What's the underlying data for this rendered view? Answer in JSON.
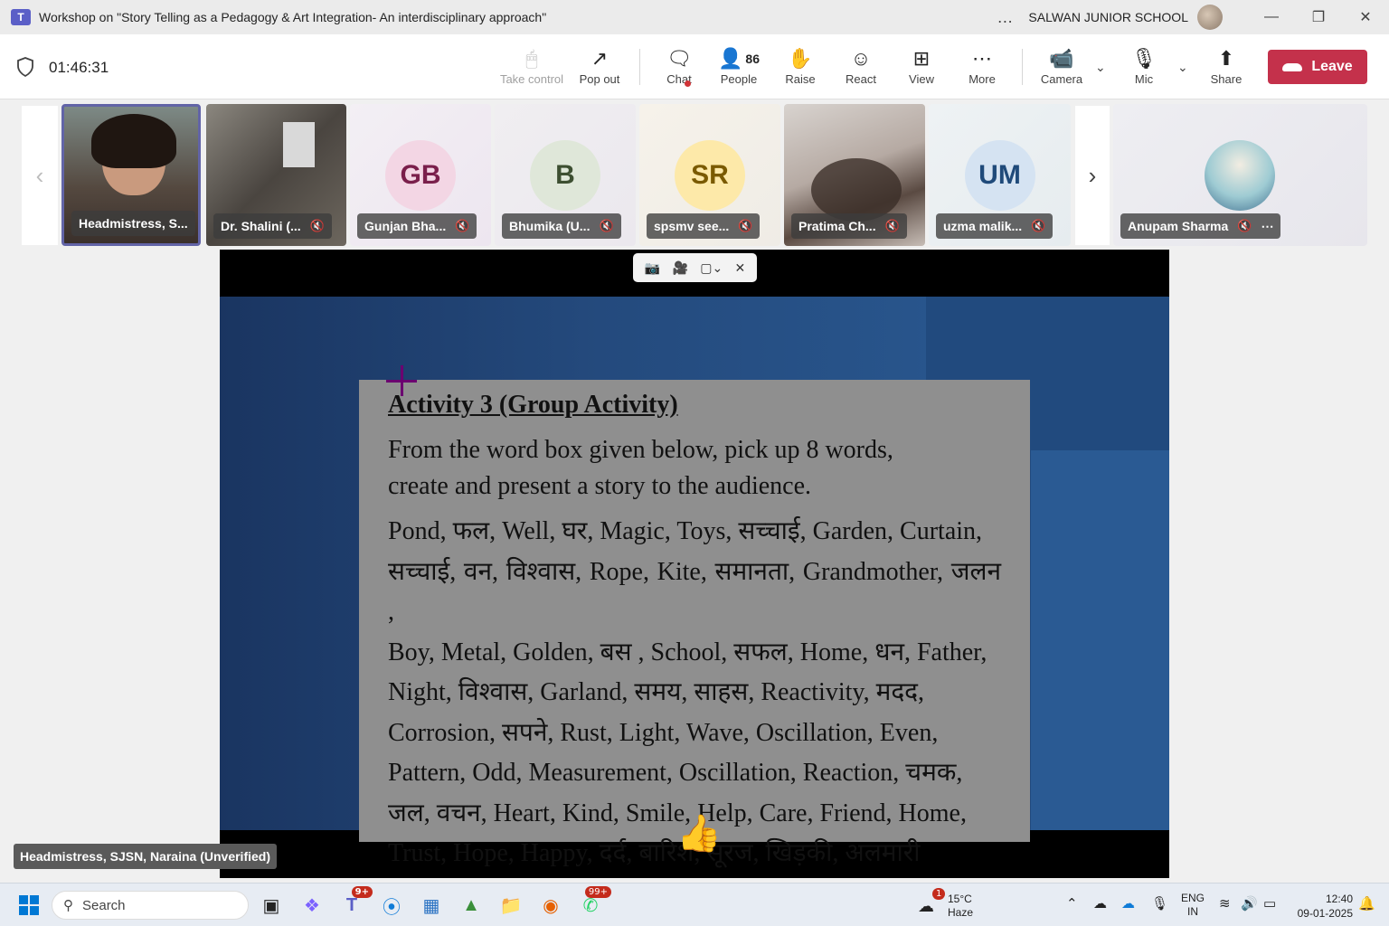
{
  "window": {
    "title": "Workshop on \"Story Telling as a Pedagogy & Art Integration- An interdisciplinary approach\"",
    "more": "…",
    "organization": "SALWAN JUNIOR SCHOOL"
  },
  "toolbar": {
    "timer": "01:46:31",
    "take_control": "Take control",
    "pop_out": "Pop out",
    "chat": "Chat",
    "people": "People",
    "people_count": "86",
    "raise": "Raise",
    "react": "React",
    "view": "View",
    "more": "More",
    "camera": "Camera",
    "mic": "Mic",
    "share": "Share",
    "leave": "Leave"
  },
  "participants": [
    {
      "name": "Headmistress, S..."
    },
    {
      "name": "Dr. Shalini (..."
    },
    {
      "initials": "GB",
      "name": "Gunjan Bha...",
      "color": "#f3d6e4",
      "text_color": "#7a1f4b"
    },
    {
      "initials": "B",
      "name": "Bhumika (U...",
      "color": "#dfe7d9",
      "text_color": "#3d4f31"
    },
    {
      "initials": "SR",
      "name": "spsmv see...",
      "color": "#fde9a9",
      "text_color": "#7a5a00"
    },
    {
      "name": "Pratima Ch..."
    },
    {
      "initials": "UM",
      "name": "uzma malik...",
      "color": "#d5e3f2",
      "text_color": "#1f4a7a"
    },
    {
      "name": "Anupam Sharma"
    }
  ],
  "slide": {
    "title": "Activity 3 (Group Activity)",
    "intro_line1": "From the word box given below, pick up 8 words,",
    "intro_line2": "create and present a story to the audience.",
    "lines": [
      "Pond, फल, Well, घर,  Magic, Toys, सच्चाई,  Garden, Curtain,",
      "सच्चाई, वन, विश्वास, Rope, Kite, समानता, Grandmother, जलन ,",
      "Boy, Metal, Golden, बस , School, सफल, Home, धन, Father,",
      "Night, विश्वास, Garland, समय, साहस,   Reactivity, मदद,",
      "Corrosion, सपने, Rust, Light, Wave, Oscillation, Even,",
      "Pattern, Odd, Measurement, Oscillation, Reaction, चमक,",
      "जल, वचन, Heart, Kind, Smile, Help, Care, Friend, Home,",
      "Trust, Hope, Happy, दर्द, बारिश, सूरज, खिड़की, अलमारी"
    ]
  },
  "speaker_label": "Headmistress, SJSN, Naraina (Unverified)",
  "taskbar": {
    "search": "Search",
    "teams_badge": "9+",
    "whatsapp_badge": "99+",
    "weather_badge": "1",
    "temperature": "15°C",
    "condition": "Haze",
    "lang1": "ENG",
    "lang2": "IN",
    "time": "12:40",
    "date": "09-01-2025"
  }
}
